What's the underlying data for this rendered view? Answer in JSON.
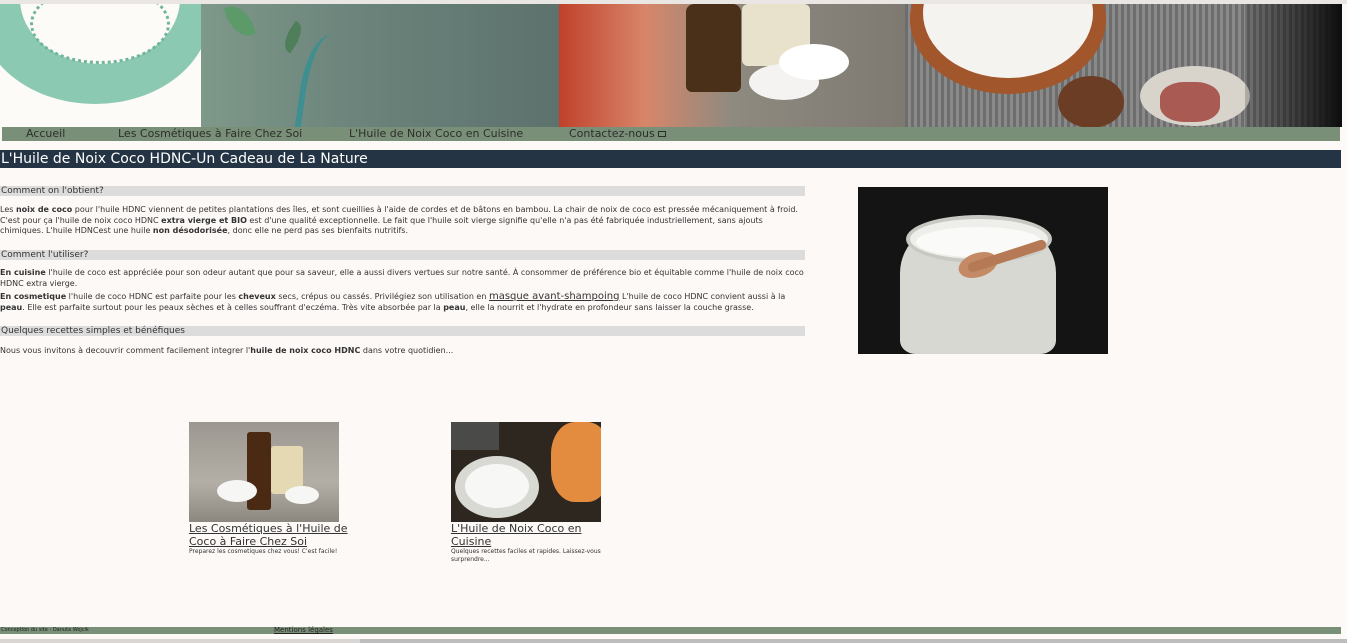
{
  "nav": {
    "items": [
      {
        "label": "Accueil"
      },
      {
        "label": "Les Cosmétiques à Faire Chez Soi"
      },
      {
        "label": "L'Huile de Noix Coco en Cuisine"
      },
      {
        "label": "Contactez-nous"
      }
    ]
  },
  "page_title": "L'Huile de Noix Coco HDNC-Un Cadeau de La Nature",
  "sections": [
    {
      "heading": "Comment on l'obtient?",
      "p1_a": "Les ",
      "p1_b": "noix de coco",
      "p1_c": " pour l'huile HDNC viennent de petites plantations des îles, et sont cueillies à l'aide de cordes et de bâtons en bambou. La chair de noix de coco est pressée mécaniquement à froid. C'est pour ça l'huile de noix coco HDNC ",
      "p1_d": "extra vierge et BIO",
      "p1_e": " est d'une qualité exceptionnelle. Le fait que l'huile soit vierge signifie qu'elle n'a pas été fabriquée industriellement, sans ajouts chimiques. L'huile HDNCest une huile ",
      "p1_f": "non désodorisée",
      "p1_g": ", donc elle ne perd pas ses bienfaits nutritifs."
    },
    {
      "heading": "Comment l'utiliser?",
      "p2_a": "En cuisine",
      "p2_b": " l'huile de coco est appréciée pour son odeur autant que pour sa saveur, elle a aussi divers vertues sur notre santé. À consommer de préférence bio et équitable comme l'huile de noix coco HDNC extra vierge.",
      "p3_a": "En cosmetique",
      "p3_b": " l'huile de coco HDNC est parfaite pour les ",
      "p3_c": "cheveux",
      "p3_d": " secs, crépus ou cassés. Privilégiez son utilisation en ",
      "p3_link": "masque avant-shampoing",
      "p3_e": " L'huile de coco HDNC convient aussi à la ",
      "p3_f": "peau",
      "p3_g": ". Elle est parfaite surtout pour les peaux sèches et à celles souffrant d'eczéma. Très vite absorbée par la ",
      "p3_h": "peau",
      "p3_i": ", elle la nourrit et l'hydrate en profondeur sans laisser la couche grasse."
    },
    {
      "heading": "Quelques recettes simples et bénéfiques",
      "p4_a": "Nous vous invitons à decouvrir comment facilement integrer l'",
      "p4_b": "huile de noix coco HDNC",
      "p4_c": " dans votre quotidien..."
    }
  ],
  "cards": [
    {
      "title": "Les Cosmétiques à l'Huile de Coco à Faire Chez Soi",
      "desc": "Preparez les cosmetiques chez vous! C'est facile!"
    },
    {
      "title": "L'Huile de Noix Coco en Cuisine",
      "desc": "Quelques recettes faciles et rapides. Laissez-vous surprendre..."
    }
  ],
  "footer": {
    "credit": "Conception du site - Danuta Wojcik",
    "legal": "Mentions légales"
  },
  "icons": {
    "contact": "mail-icon"
  },
  "colors": {
    "nav_bg": "#7a8f78",
    "title_bg": "#253444",
    "section_bg": "#dcdcdc",
    "page_bg": "#fdf9f7"
  }
}
